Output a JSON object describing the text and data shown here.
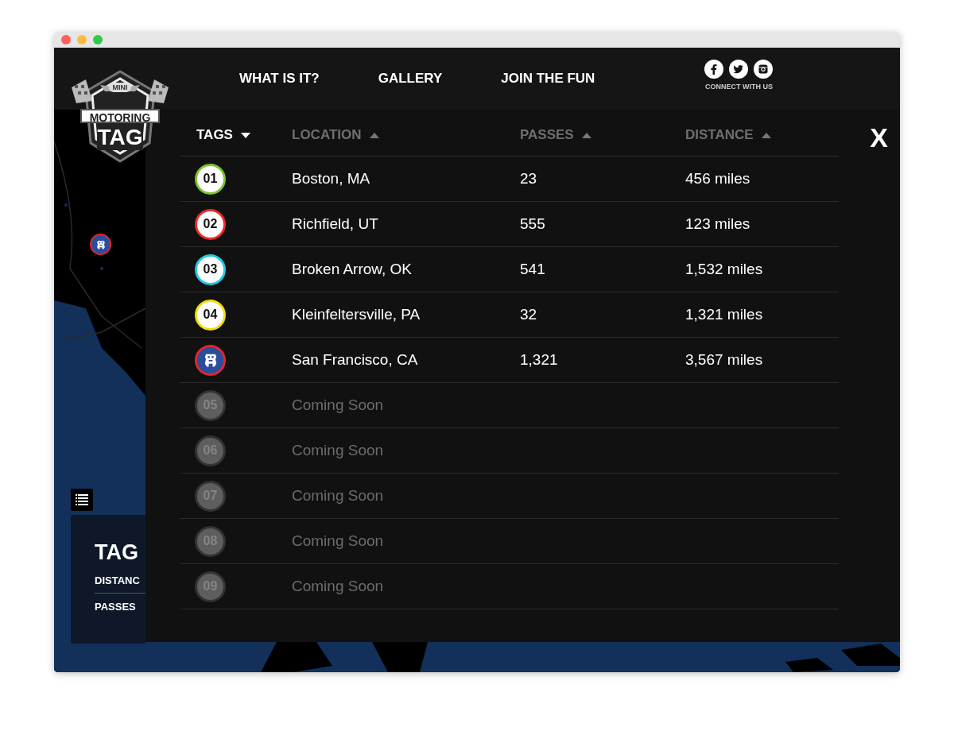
{
  "nav": {
    "logo": {
      "badge": "MINI",
      "line_1": "MOTORING",
      "line_2": "TAG"
    },
    "links": [
      "WHAT IS IT?",
      "GALLERY",
      "JOIN THE FUN"
    ],
    "social": {
      "caption": "CONNECT WITH US"
    }
  },
  "info_card": {
    "title": "TAG",
    "rows": [
      "DISTANC",
      "PASSES"
    ]
  },
  "panel": {
    "close": "X",
    "columns": [
      {
        "label": "TAGS",
        "selected": true,
        "ascending": false
      },
      {
        "label": "LOCATION",
        "selected": false,
        "ascending": true
      },
      {
        "label": "PASSES",
        "selected": false,
        "ascending": true
      },
      {
        "label": "DISTANCE",
        "selected": false,
        "ascending": true
      }
    ],
    "rows": [
      {
        "kind": "number",
        "tag": "01",
        "color": "#7dc22e",
        "location": "Boston, MA",
        "passes": "23",
        "distance": "456 miles"
      },
      {
        "kind": "number",
        "tag": "02",
        "color": "#ee2a24",
        "location": "Richfield, UT",
        "passes": "555",
        "distance": "123 miles"
      },
      {
        "kind": "number",
        "tag": "03",
        "color": "#23c6e6",
        "location": "Broken Arrow, OK",
        "passes": "541",
        "distance": "1,532 miles"
      },
      {
        "kind": "number",
        "tag": "04",
        "color": "#f4dd0a",
        "location": "Kleinfeltersville, PA",
        "passes": "32",
        "distance": "1,321 miles"
      },
      {
        "kind": "mascot",
        "color": "#e3262b",
        "location": "San Francisco, CA",
        "passes": "1,321",
        "distance": "3,567 miles"
      },
      {
        "kind": "soon",
        "tag": "05",
        "location": "Coming Soon"
      },
      {
        "kind": "soon",
        "tag": "06",
        "location": "Coming Soon"
      },
      {
        "kind": "soon",
        "tag": "07",
        "location": "Coming Soon"
      },
      {
        "kind": "soon",
        "tag": "08",
        "location": "Coming Soon"
      },
      {
        "kind": "soon",
        "tag": "09",
        "location": "Coming Soon"
      }
    ]
  }
}
